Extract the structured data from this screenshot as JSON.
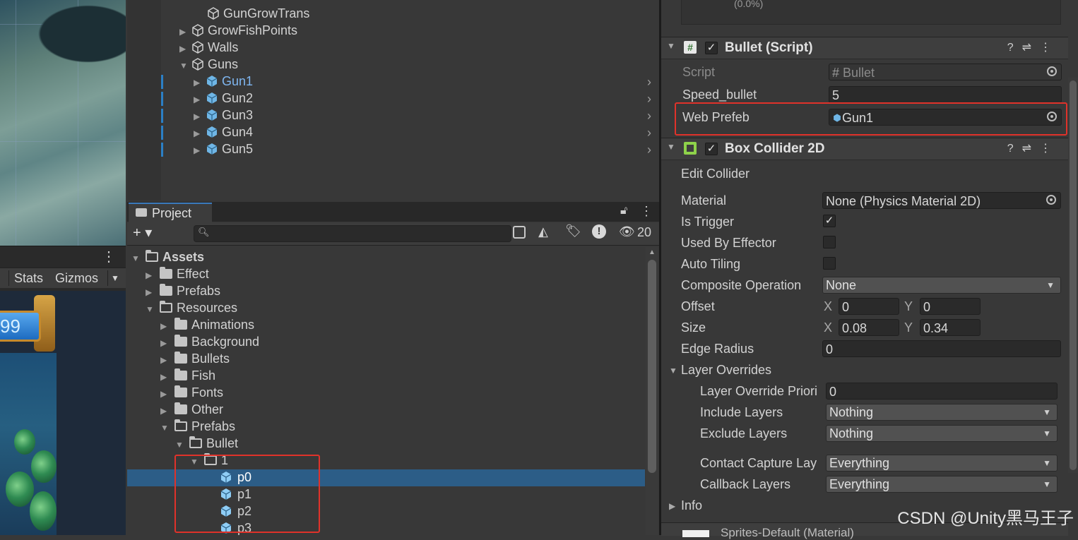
{
  "hierarchy": {
    "items": [
      {
        "label": "GunGrowTrans",
        "arrow": ""
      },
      {
        "label": "GrowFishPoints",
        "arrow": "▶"
      },
      {
        "label": "Walls",
        "arrow": "▶"
      },
      {
        "label": "Guns",
        "arrow": "▼"
      },
      {
        "label": "Gun1",
        "arrow": "▶"
      },
      {
        "label": "Gun2",
        "arrow": "▶"
      },
      {
        "label": "Gun3",
        "arrow": "▶"
      },
      {
        "label": "Gun4",
        "arrow": "▶"
      },
      {
        "label": "Gun5",
        "arrow": "▶"
      }
    ]
  },
  "scene": {
    "stats_label": "Stats",
    "gizmos_label": "Gizmos",
    "score": "99",
    "more": "⋮"
  },
  "project": {
    "tab_label": "Project",
    "add_label": "+ ▾",
    "hidden_count": "20",
    "tree": [
      {
        "label": "Assets",
        "arrow": "▼",
        "open": true
      },
      {
        "label": "Effect",
        "arrow": "▶"
      },
      {
        "label": "Prefabs",
        "arrow": "▶"
      },
      {
        "label": "Resources",
        "arrow": "▼",
        "open": true
      },
      {
        "label": "Animations",
        "arrow": "▶"
      },
      {
        "label": "Background",
        "arrow": "▶"
      },
      {
        "label": "Bullets",
        "arrow": "▶"
      },
      {
        "label": "Fish",
        "arrow": "▶"
      },
      {
        "label": "Fonts",
        "arrow": "▶"
      },
      {
        "label": "Other",
        "arrow": "▶"
      },
      {
        "label": "Prefabs",
        "arrow": "▼",
        "open": true
      },
      {
        "label": "Bullet",
        "arrow": "▼",
        "open": true
      },
      {
        "label": "1",
        "arrow": "▼",
        "open": true
      },
      {
        "label": "p0"
      },
      {
        "label": "p1"
      },
      {
        "label": "p2"
      },
      {
        "label": "p3"
      }
    ]
  },
  "inspector": {
    "top_value": "(0.0%)",
    "bullet_script": {
      "title": "Bullet (Script)",
      "script_label": "Script",
      "script_value": "Bullet",
      "speed_label": "Speed_bullet",
      "speed_value": "5",
      "web_prefab_label": "Web Prefeb",
      "web_prefab_value": "Gun1"
    },
    "box_collider": {
      "title": "Box Collider 2D",
      "edit_collider": "Edit Collider",
      "material_label": "Material",
      "material_value": "None (Physics Material 2D)",
      "is_trigger_label": "Is Trigger",
      "used_by_effector_label": "Used By Effector",
      "auto_tiling_label": "Auto Tiling",
      "composite_label": "Composite Operation",
      "composite_value": "None",
      "offset_label": "Offset",
      "offset_x": "0",
      "offset_y": "0",
      "size_label": "Size",
      "size_x": "0.08",
      "size_y": "0.34",
      "x_label": "X",
      "y_label": "Y",
      "edge_radius_label": "Edge Radius",
      "edge_radius_value": "0",
      "layer_overrides_label": "Layer Overrides",
      "layer_override_priority_label": "Layer Override Priori",
      "layer_override_priority_value": "0",
      "include_layers_label": "Include Layers",
      "include_layers_value": "Nothing",
      "exclude_layers_label": "Exclude Layers",
      "exclude_layers_value": "Nothing",
      "contact_capture_label": "Contact Capture Lay",
      "contact_capture_value": "Everything",
      "callback_layers_label": "Callback Layers",
      "callback_layers_value": "Everything",
      "info_label": "Info",
      "material_bottom": "Sprites-Default (Material)"
    }
  },
  "watermark": "CSDN @Unity黑马王子",
  "colors": {
    "accent": "#2b7fc5",
    "highlight_box": "#e0322a",
    "selection": "#2c5d87"
  }
}
